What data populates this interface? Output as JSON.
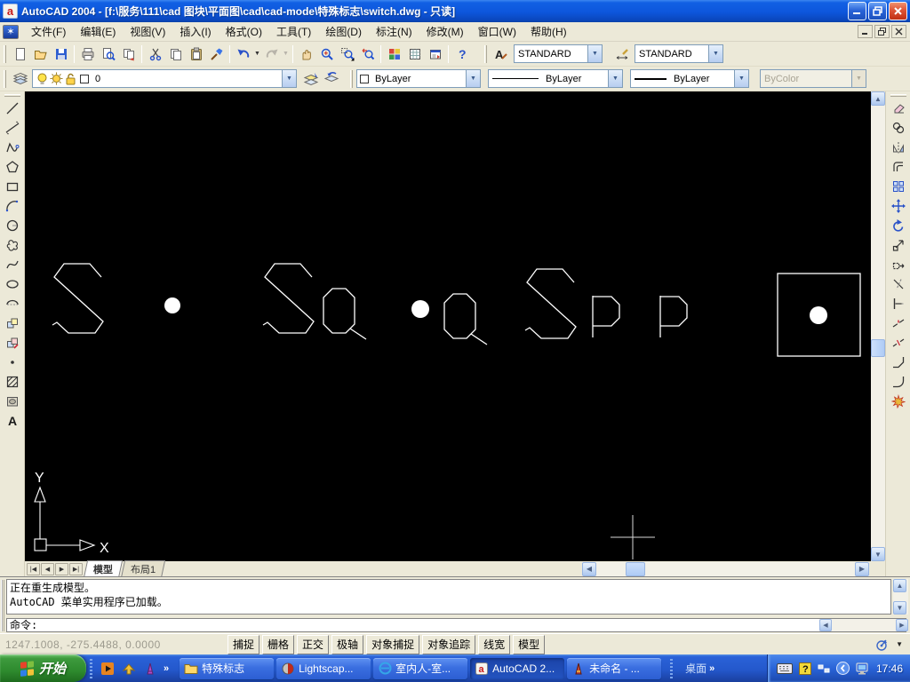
{
  "titlebar": {
    "title": "AutoCAD 2004 - [f:\\服务\\111\\cad 图块\\平面图\\cad\\cad-mode\\特殊标志\\switch.dwg - 只读]"
  },
  "menubar": {
    "items": [
      "文件(F)",
      "编辑(E)",
      "视图(V)",
      "插入(I)",
      "格式(O)",
      "工具(T)",
      "绘图(D)",
      "标注(N)",
      "修改(M)",
      "窗口(W)",
      "帮助(H)"
    ]
  },
  "toolbars": {
    "text_style": "STANDARD",
    "dim_style": "STANDARD",
    "layer_name": "0",
    "color": "ByLayer",
    "linetype": "ByLayer",
    "lineweight": "ByLayer",
    "plot_style": "ByColor"
  },
  "canvas": {
    "axis_x": "X",
    "axis_y": "Y"
  },
  "layout_tabs": {
    "model": "模型",
    "layout1": "布局1"
  },
  "command": {
    "history_line1": "正在重生成模型。",
    "history_line2": "AutoCAD 菜单实用程序已加载。",
    "prompt": "命令:"
  },
  "statusbar": {
    "coordinates": "1247.1008, -275.4488, 0.0000",
    "toggles": [
      "捕捉",
      "栅格",
      "正交",
      "极轴",
      "对象捕捉",
      "对象追踪",
      "线宽",
      "模型"
    ]
  },
  "taskbar": {
    "start": "开始",
    "desktop": "桌面",
    "chevron": "»",
    "clock": "17:46",
    "tasks": [
      "特殊标志",
      "Lightscap...",
      "室内人-室...",
      "AutoCAD 2...",
      "未命名 - ..."
    ]
  },
  "colors": {
    "titlebar_blue": "#0D56DC",
    "taskbar_blue": "#2458CC",
    "start_green": "#2E8A2E",
    "toolbar_beige": "#ECE9D8",
    "canvas_bg": "#000000",
    "geometry_white": "#FFFFFF",
    "active_task_blue": "#1C44A8"
  }
}
